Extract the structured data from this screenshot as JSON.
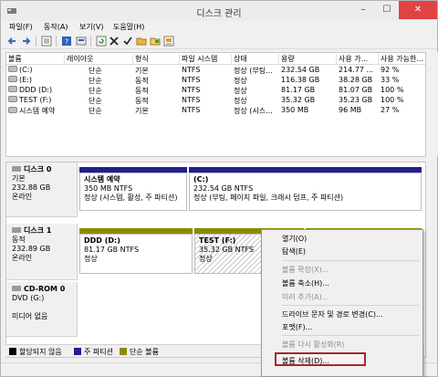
{
  "window": {
    "title": "디스크 관리",
    "min": "–",
    "max": "☐",
    "close": "✕"
  },
  "menu": [
    "파일(F)",
    "동작(A)",
    "보기(V)",
    "도움말(H)"
  ],
  "toolbar_icons": [
    "back-icon",
    "forward-icon",
    "list-icon",
    "help-icon",
    "disk-props-icon",
    "refresh-icon",
    "delete-icon",
    "check-icon",
    "folder-open-icon",
    "folder-icon",
    "properties-icon"
  ],
  "volume_table": {
    "headers": [
      "볼륨",
      "레이아웃",
      "형식",
      "파일 시스템",
      "상태",
      "용량",
      "사용 가...",
      "사용 가능한..."
    ],
    "rows": [
      [
        "(C:)",
        "단순",
        "기본",
        "NTFS",
        "정상 (부팅...",
        "232.54 GB",
        "214.77 ...",
        "92 %"
      ],
      [
        "(E:)",
        "단순",
        "동적",
        "NTFS",
        "정상",
        "116.38 GB",
        "38.28 GB",
        "33 %"
      ],
      [
        "DDD (D:)",
        "단순",
        "동적",
        "NTFS",
        "정상",
        "81.17 GB",
        "81.07 GB",
        "100 %"
      ],
      [
        "TEST (F:)",
        "단순",
        "동적",
        "NTFS",
        "정상",
        "35.32 GB",
        "35.23 GB",
        "100 %"
      ],
      [
        "시스템 예약",
        "단순",
        "기본",
        "NTFS",
        "정상 (시스...",
        "350 MB",
        "96 MB",
        "27 %"
      ]
    ]
  },
  "disks": [
    {
      "name": "디스크 0",
      "type": "기본",
      "size": "232.88 GB",
      "state": "온라인",
      "partitions": [
        {
          "title": "시스템 예약",
          "size": "350 MB NTFS",
          "status": "정상 (시스템, 활성, 주 파티션)"
        },
        {
          "title": "(C:)",
          "size": "232.54 GB NTFS",
          "status": "정상 (부팅, 페이지 파일, 크래시 덤프, 주 파티션)"
        }
      ]
    },
    {
      "name": "디스크 1",
      "type": "동적",
      "size": "232.89 GB",
      "state": "온라인",
      "partitions": [
        {
          "title": "DDD  (D:)",
          "size": "81.17 GB NTFS",
          "status": "정상"
        },
        {
          "title": "TEST  (F:)",
          "size": "35.32 GB NTFS",
          "status": "정상"
        }
      ]
    },
    {
      "name": "CD-ROM 0",
      "type": "DVD (G:)",
      "size": "",
      "state": "미디어 없음",
      "partitions": []
    }
  ],
  "legend": [
    {
      "label": "할당되지 않음",
      "color": "#000000"
    },
    {
      "label": "주 파티션",
      "color": "#1f1f8f"
    },
    {
      "label": "단순 볼륨",
      "color": "#8b8b00"
    }
  ],
  "context_menu": {
    "items": [
      {
        "label": "열기(O)",
        "enabled": true
      },
      {
        "label": "탐색(E)",
        "enabled": true
      },
      {
        "label": "볼륨 확장(X)...",
        "enabled": false
      },
      {
        "label": "볼륨 축소(H)...",
        "enabled": true
      },
      {
        "label": "미러 추가(A)...",
        "enabled": false
      },
      {
        "label": "드라이브 문자 및 경로 변경(C)...",
        "enabled": true
      },
      {
        "label": "포맷(F)...",
        "enabled": true
      },
      {
        "label": "볼륨 다시 활성화(R)",
        "enabled": false
      },
      {
        "label": "볼륨 삭제(D)...",
        "enabled": true,
        "highlighted": true
      }
    ]
  },
  "colors": {
    "primary_partition": "#1f1f8f",
    "simple_volume": "#8b8b00",
    "highlight_border": "#a8262b"
  }
}
